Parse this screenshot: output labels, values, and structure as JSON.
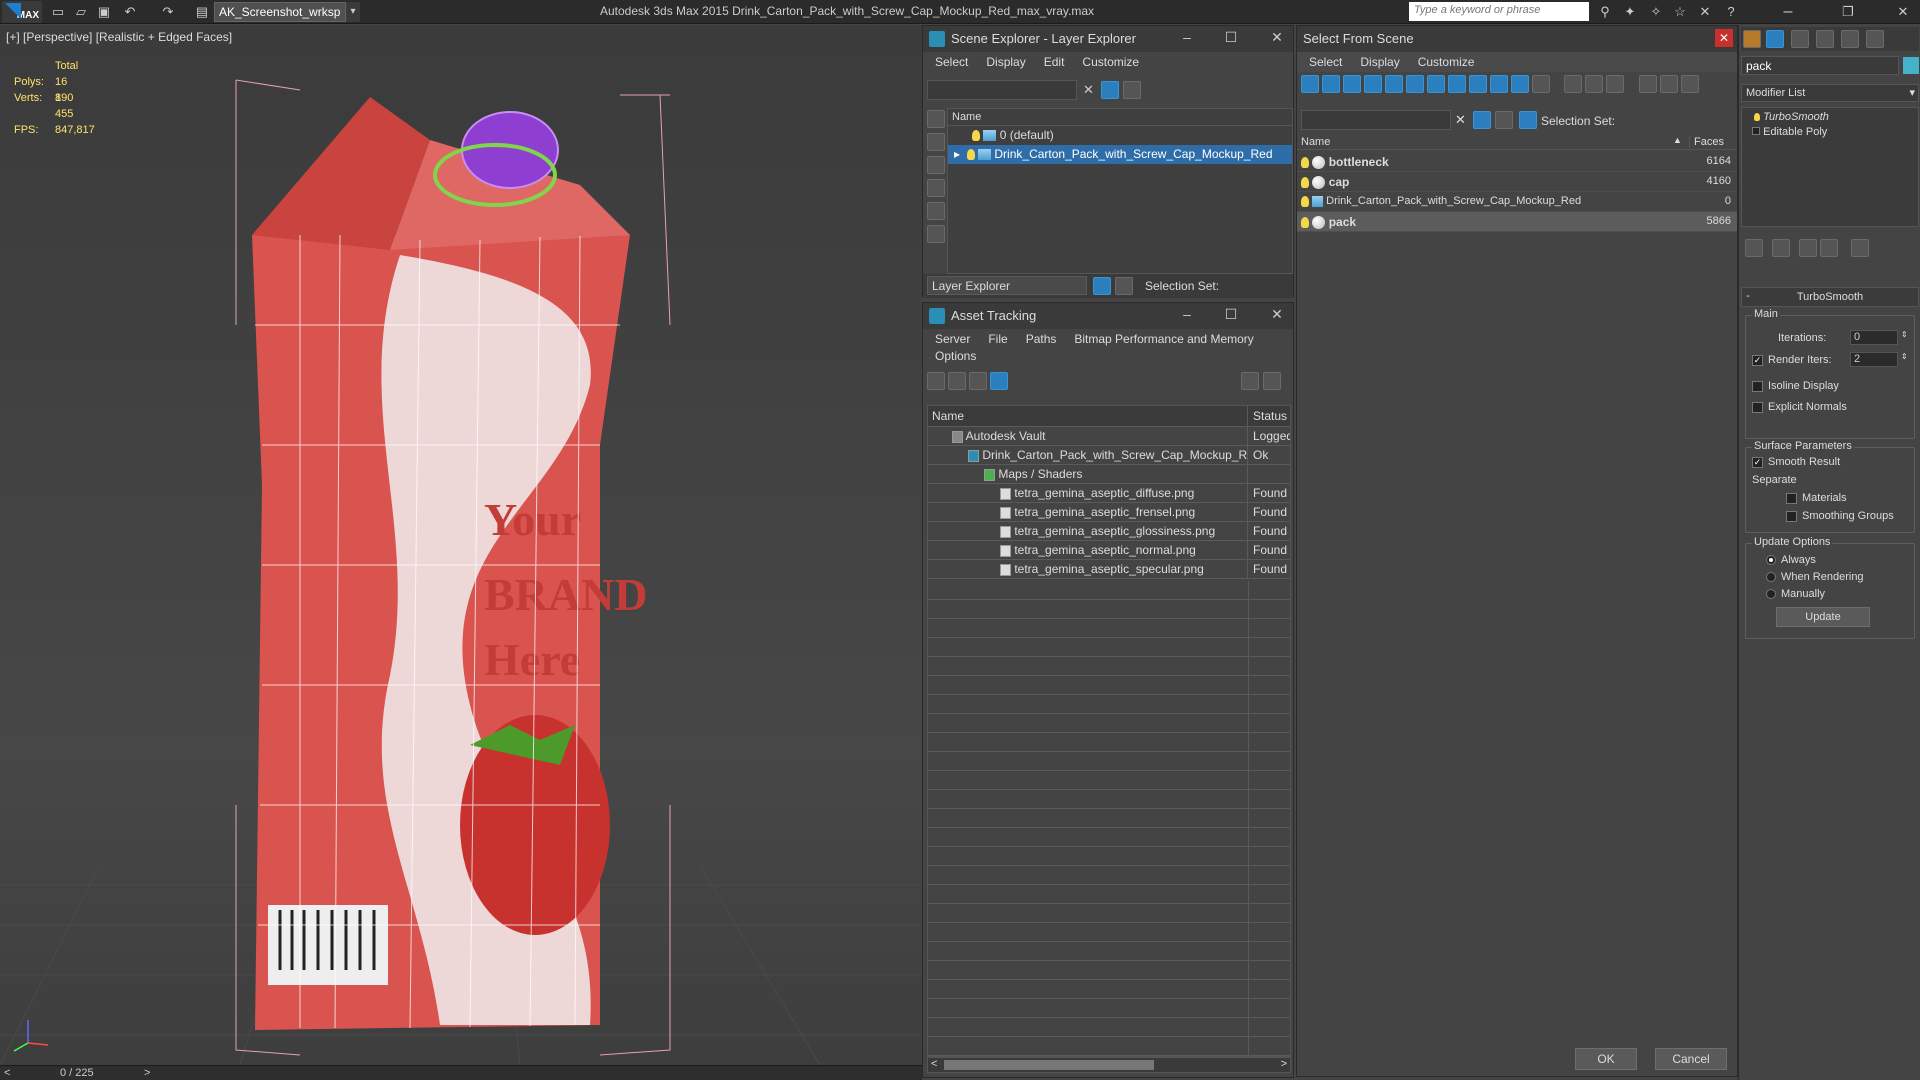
{
  "app": {
    "window_title": "Autodesk 3ds Max  2015    Drink_Carton_Pack_with_Screw_Cap_Mockup_Red_max_vray.max",
    "logo_text": "MAX",
    "workspace": "AK_Screenshot_wrksp",
    "search_placeholder": "Type a keyword or phrase"
  },
  "viewport": {
    "label": "[+] [Perspective] [Realistic + Edged Faces]",
    "stats": {
      "total_label": "Total",
      "polys_label": "Polys:",
      "polys_value": "16 190",
      "verts_label": "Verts:",
      "verts_value": "8 455",
      "fps_label": "FPS:",
      "fps_value": "847,817"
    },
    "carton_text": {
      "line1": "Your",
      "line2": "BRAND",
      "line3": "Here"
    },
    "timeline": "0 / 225"
  },
  "scene_explorer": {
    "title": "Scene Explorer - Layer Explorer",
    "menu": [
      "Select",
      "Display",
      "Edit",
      "Customize"
    ],
    "column_name": "Name",
    "layers": [
      {
        "name": "0 (default)"
      },
      {
        "name": "Drink_Carton_Pack_with_Screw_Cap_Mockup_Red"
      }
    ],
    "footer_dropdown": "Layer Explorer",
    "selection_set_label": "Selection Set:"
  },
  "asset_tracking": {
    "title": "Asset Tracking",
    "menu": [
      "Server",
      "File",
      "Paths",
      "Bitmap Performance and Memory"
    ],
    "menu2": "Options",
    "col_name": "Name",
    "col_status": "Status",
    "rows": [
      {
        "name": "Autodesk Vault",
        "status": "Logged"
      },
      {
        "name": "Drink_Carton_Pack_with_Screw_Cap_Mockup_R...",
        "status": "Ok"
      },
      {
        "name": "Maps / Shaders",
        "status": ""
      },
      {
        "name": "tetra_gemina_aseptic_diffuse.png",
        "status": "Found"
      },
      {
        "name": "tetra_gemina_aseptic_frensel.png",
        "status": "Found"
      },
      {
        "name": "tetra_gemina_aseptic_glossiness.png",
        "status": "Found"
      },
      {
        "name": "tetra_gemina_aseptic_normal.png",
        "status": "Found"
      },
      {
        "name": "tetra_gemina_aseptic_specular.png",
        "status": "Found"
      }
    ]
  },
  "select_from_scene": {
    "title": "Select From Scene",
    "menu": [
      "Select",
      "Display",
      "Customize"
    ],
    "selection_set_label": "Selection Set:",
    "col_name": "Name",
    "col_faces": "Faces",
    "rows": [
      {
        "name": "bottleneck",
        "faces": "6164",
        "bold": true
      },
      {
        "name": "cap",
        "faces": "4160",
        "bold": true
      },
      {
        "name": "Drink_Carton_Pack_with_Screw_Cap_Mockup_Red",
        "faces": "0",
        "bold": false
      },
      {
        "name": "pack",
        "faces": "5866",
        "bold": true
      }
    ],
    "ok": "OK",
    "cancel": "Cancel"
  },
  "command_panel": {
    "object_name": "pack",
    "modifier_list": "Modifier List",
    "stack": [
      "TurboSmooth",
      "Editable Poly"
    ],
    "rollout_title": "TurboSmooth",
    "main_label": "Main",
    "iterations_label": "Iterations:",
    "iterations_value": "0",
    "render_iters_label": "Render Iters:",
    "render_iters_value": "2",
    "isoline": "Isoline Display",
    "explicit_normals": "Explicit Normals",
    "surface_params": "Surface Parameters",
    "smooth_result": "Smooth Result",
    "separate": "Separate",
    "materials": "Materials",
    "smoothing_groups": "Smoothing Groups",
    "update_options": "Update Options",
    "always": "Always",
    "when_rendering": "When Rendering",
    "manually": "Manually",
    "update_btn": "Update"
  },
  "colors": {
    "accent": "#2c7fbf",
    "stats_yellow": "#ffe36a",
    "carton_red": "#d84a46"
  }
}
